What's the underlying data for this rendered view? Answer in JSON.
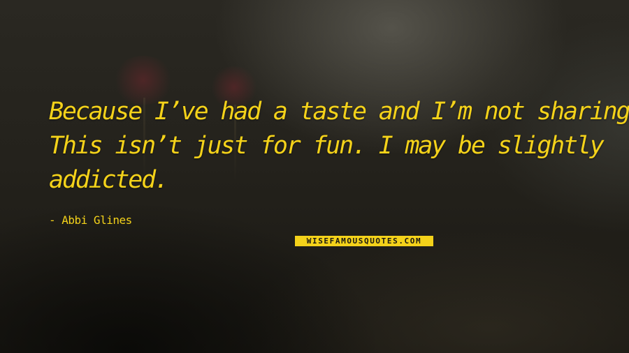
{
  "quote": {
    "lines": [
      "Because I’ve had a taste and I’m not sharing.",
      "This isn’t just for fun. I may be slightly",
      "addicted."
    ],
    "author": "- Abbi Glines"
  },
  "watermark": {
    "text": "WISEFAMOUSQUOTES.COM"
  },
  "colors": {
    "text": "#f4d21a",
    "background": "#24221c"
  }
}
